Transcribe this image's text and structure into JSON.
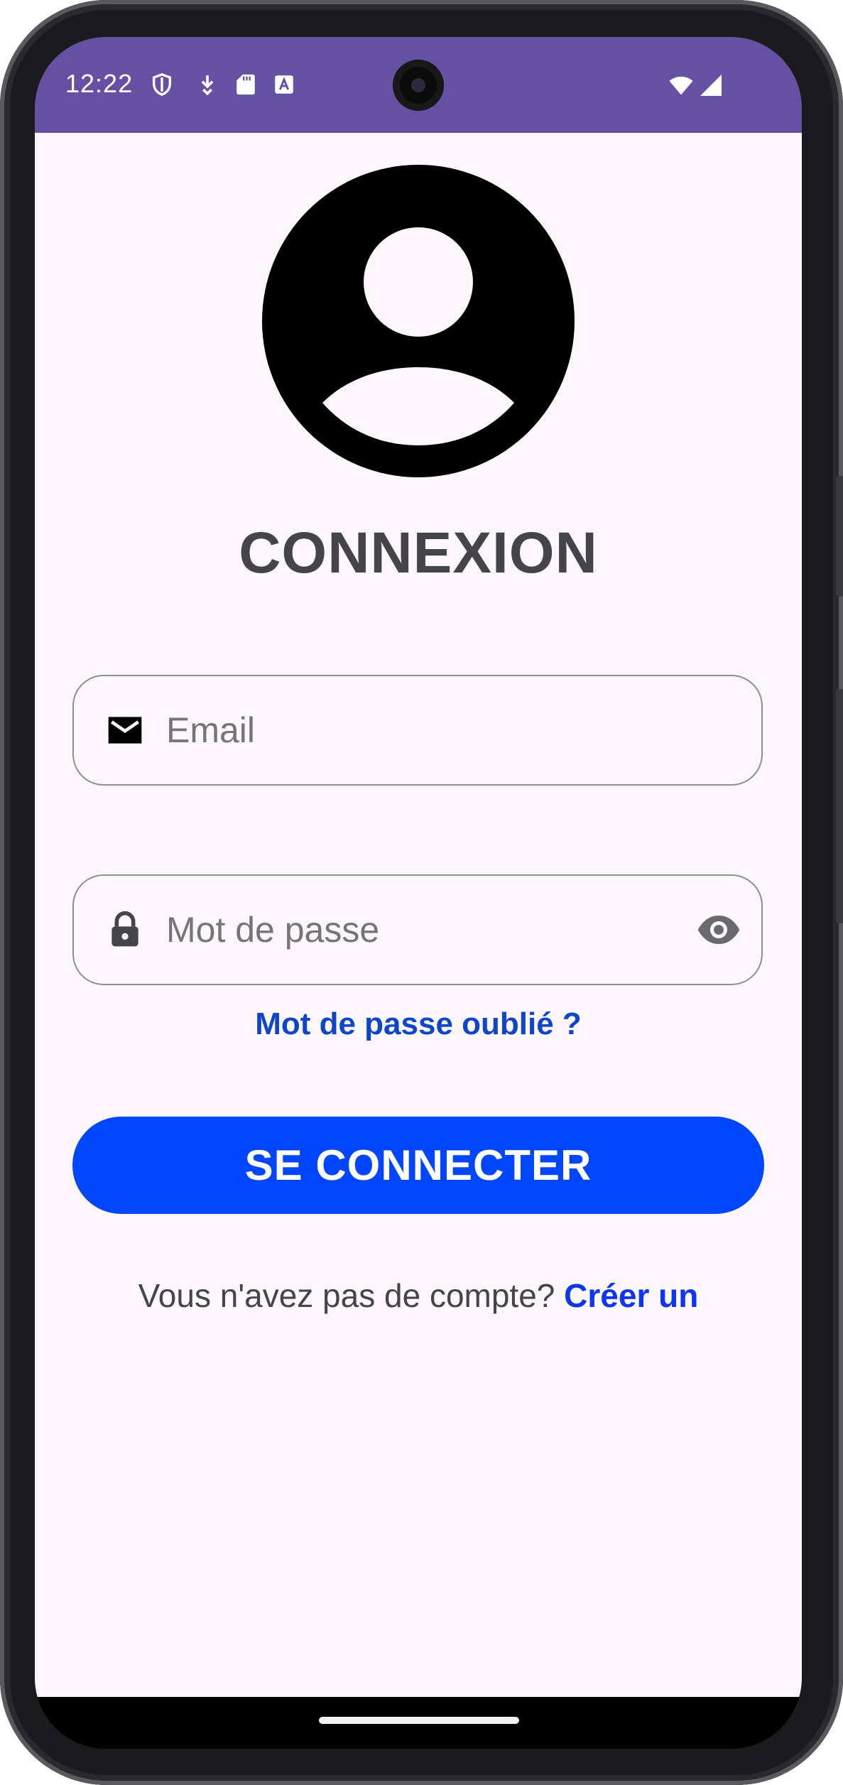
{
  "status_bar": {
    "time": "12:22",
    "background": "#6650a4",
    "left_icons": [
      "shield-icon",
      "download-icon",
      "sd-card-icon",
      "keyboard-a-icon"
    ],
    "right_icons": [
      "wifi-icon",
      "cell-signal-icon"
    ]
  },
  "login": {
    "avatar_icon": "account-circle-icon",
    "title": "CONNEXION",
    "email": {
      "icon": "email-icon",
      "placeholder": "Email",
      "value": ""
    },
    "password": {
      "icon": "lock-icon",
      "placeholder": "Mot de passe",
      "value": "",
      "toggle_icon": "eye-icon"
    },
    "forgot_password": "Mot de passe oublié ?",
    "submit_label": "SE CONNECTER",
    "signup_prompt": "Vous n'avez pas de compte?",
    "signup_link": "Créer un"
  },
  "colors": {
    "primary_button": "#0046ff",
    "link": "#0d47c7",
    "signup_link": "#0c36f2",
    "screen_background": "#fdf7fc",
    "title_text": "#45444a"
  }
}
